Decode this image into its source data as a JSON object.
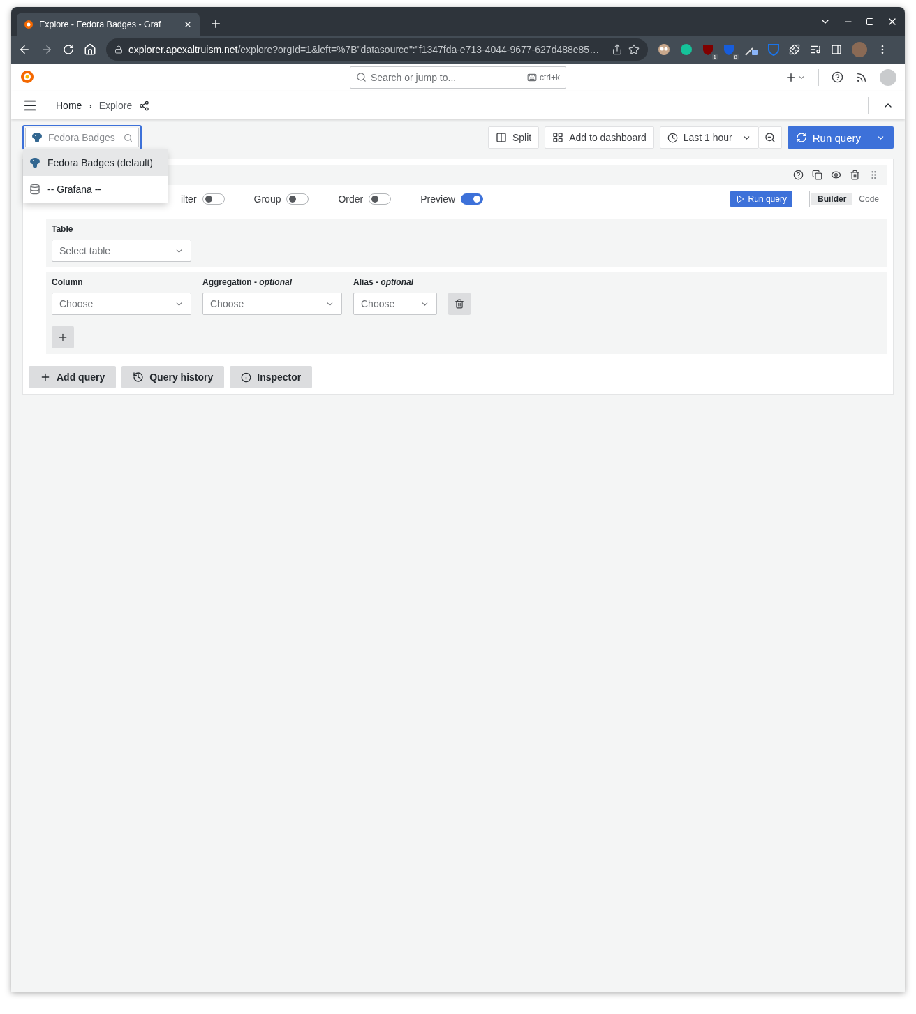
{
  "browser": {
    "tab_title": "Explore - Fedora Badges - Graf",
    "url_host": "explorer.apexaltruism.net",
    "url_path": "/explore?orgId=1&left=%7B\"datasource\":\"f1347fda-e713-4044-9677-627d488e85…",
    "extension_badges": [
      "1",
      "8"
    ]
  },
  "topbar": {
    "search_placeholder": "Search or jump to...",
    "shortcut": "ctrl+k"
  },
  "breadcrumbs": {
    "separator": "›",
    "items": [
      {
        "label": "Home",
        "selected": false
      },
      {
        "label": "Explore",
        "selected": true
      }
    ]
  },
  "datasource_picker": {
    "placeholder": "Fedora Badges",
    "options": [
      {
        "label": "Fedora Badges (default)",
        "kind": "postgres",
        "selected": true
      },
      {
        "label": "-- Grafana --",
        "kind": "grafana",
        "selected": false
      }
    ]
  },
  "toolbar": {
    "split": "Split",
    "add_to_dashboard": "Add to dashboard",
    "time_range": "Last 1 hour",
    "run_query": "Run query"
  },
  "query": {
    "toggles": [
      {
        "label": "ilter",
        "on": false
      },
      {
        "label": "Group",
        "on": false
      },
      {
        "label": "Order",
        "on": false
      },
      {
        "label": "Preview",
        "on": true
      }
    ],
    "run_query": "Run query",
    "modes": [
      {
        "label": "Builder",
        "selected": true
      },
      {
        "label": "Code",
        "selected": false
      }
    ],
    "table": {
      "label": "Table",
      "placeholder": "Select table"
    },
    "columns": [
      {
        "label": "Column",
        "placeholder": "Choose"
      },
      {
        "label": "Aggregation - *optional*",
        "placeholder": "Choose"
      },
      {
        "label": "Alias - *optional*",
        "placeholder": "Choose"
      }
    ]
  },
  "actions": [
    {
      "label": "Add query",
      "kind": "add"
    },
    {
      "label": "Query history",
      "kind": "history"
    },
    {
      "label": "Inspector",
      "kind": "info"
    }
  ]
}
